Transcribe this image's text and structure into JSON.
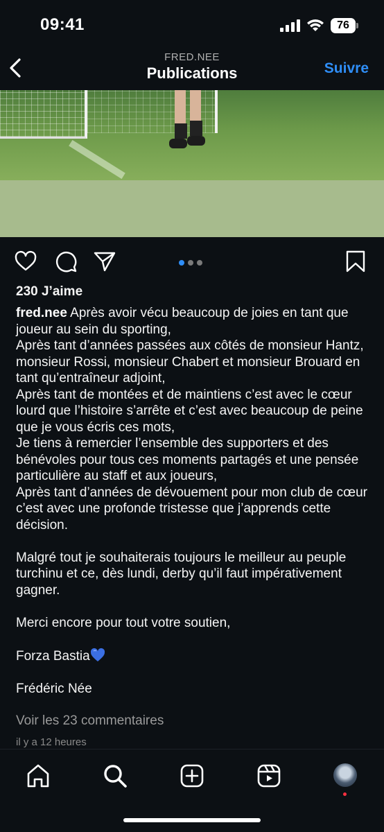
{
  "status_bar": {
    "time": "09:41",
    "battery": "76"
  },
  "header": {
    "username": "FRED.NEE",
    "title": "Publications",
    "follow_label": "Suivre"
  },
  "post": {
    "likes": "230 J’aime",
    "author": "fred.nee",
    "caption_lines": [
      "Après avoir vécu beaucoup de joies en tant que joueur au sein du sporting,",
      "Après tant d’années passées aux côtés de monsieur Hantz, monsieur Rossi, monsieur Chabert et monsieur Brouard en tant qu’entraîneur adjoint,",
      "Après tant de montées et de maintiens c’est avec le cœur lourd que l’histoire s’arrête et c’est avec beaucoup de peine que je vous écris ces mots,",
      "Je tiens à remercier l’ensemble des supporters et des bénévoles pour tous ces moments partagés et une pensée particulière au staff et aux joueurs,",
      "Après tant d’années de dévouement pour mon club de cœur c’est avec une profonde tristesse que j’apprends cette décision.",
      "Malgré tout je souhaiterais toujours le meilleur au peuple turchinu et ce, dès lundi, derby qu’il faut impérativement gagner.",
      "Merci encore pour tout votre soutien,",
      "Forza Bastia",
      "Frédéric Née"
    ],
    "view_comments": "Voir les 23 commentaires",
    "time_ago": "il y a 12 heures",
    "carousel": {
      "count": 3,
      "active_index": 0
    }
  },
  "icons": {
    "actions": [
      "heart-icon",
      "comment-icon",
      "share-icon",
      "bookmark-icon"
    ],
    "nav": [
      "home-icon",
      "search-icon",
      "create-icon",
      "reels-icon",
      "profile-avatar"
    ],
    "emoji": "blue-heart"
  },
  "colors": {
    "accent": "#2f8ef7",
    "background": "#0c1014",
    "notification": "#ff3040"
  }
}
